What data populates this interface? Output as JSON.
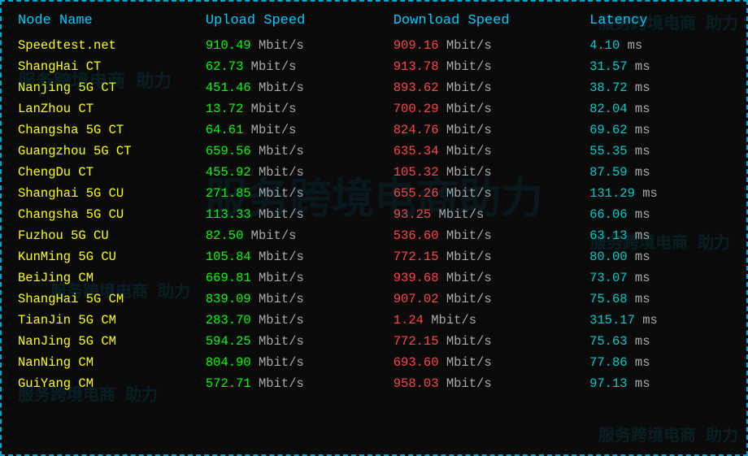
{
  "header": {
    "columns": [
      "Node Name",
      "Upload Speed",
      "Download Speed",
      "Latency"
    ]
  },
  "rows": [
    {
      "name": "Speedtest.net",
      "upload": "910.49",
      "download": "909.16",
      "latency": "4.10",
      "unit_u": "Mbit/s",
      "unit_d": "Mbit/s",
      "unit_l": "ms"
    },
    {
      "name": "ShangHai   CT",
      "upload": "62.73",
      "download": "913.78",
      "latency": "31.57",
      "unit_u": "Mbit/s",
      "unit_d": "Mbit/s",
      "unit_l": "ms"
    },
    {
      "name": "Nanjing 5G  CT",
      "upload": "451.46",
      "download": "893.62",
      "latency": "38.72",
      "unit_u": "Mbit/s",
      "unit_d": "Mbit/s",
      "unit_l": "ms"
    },
    {
      "name": "LanZhou   CT",
      "upload": "13.72",
      "download": "700.29",
      "latency": "82.04",
      "unit_u": "Mbit/s",
      "unit_d": "Mbit/s",
      "unit_l": "ms"
    },
    {
      "name": "Changsha 5G  CT",
      "upload": "64.61",
      "download": "824.76",
      "latency": "69.62",
      "unit_u": "Mbit/s",
      "unit_d": "Mbit/s",
      "unit_l": "ms"
    },
    {
      "name": "Guangzhou 5G CT",
      "upload": "659.56",
      "download": "635.34",
      "latency": "55.35",
      "unit_u": "Mbit/s",
      "unit_d": "Mbit/s",
      "unit_l": "ms"
    },
    {
      "name": "ChengDu   CT",
      "upload": "455.92",
      "download": "105.32",
      "latency": "87.59",
      "unit_u": "Mbit/s",
      "unit_d": "Mbit/s",
      "unit_l": "ms"
    },
    {
      "name": "Shanghai 5G  CU",
      "upload": "271.85",
      "download": "655.26",
      "latency": "131.29",
      "unit_u": "Mbit/s",
      "unit_d": "Mbit/s",
      "unit_l": "ms"
    },
    {
      "name": "Changsha 5G  CU",
      "upload": "113.33",
      "download": "93.25",
      "latency": "66.06",
      "unit_u": "Mbit/s",
      "unit_d": "Mbit/s",
      "unit_l": "ms"
    },
    {
      "name": "Fuzhou 5G   CU",
      "upload": "82.50",
      "download": "536.60",
      "latency": "63.13",
      "unit_u": "Mbit/s",
      "unit_d": "Mbit/s",
      "unit_l": "ms"
    },
    {
      "name": "KunMing 5G  CU",
      "upload": "105.84",
      "download": "772.15",
      "latency": "80.00",
      "unit_u": "Mbit/s",
      "unit_d": "Mbit/s",
      "unit_l": "ms"
    },
    {
      "name": "BeiJing    CM",
      "upload": "669.81",
      "download": "939.68",
      "latency": "73.07",
      "unit_u": "Mbit/s",
      "unit_d": "Mbit/s",
      "unit_l": "ms"
    },
    {
      "name": "ShangHai 5G  CM",
      "upload": "839.09",
      "download": "907.02",
      "latency": "75.68",
      "unit_u": "Mbit/s",
      "unit_d": "Mbit/s",
      "unit_l": "ms"
    },
    {
      "name": "TianJin 5G  CM",
      "upload": "283.70",
      "download": "1.24",
      "latency": "315.17",
      "unit_u": "Mbit/s",
      "unit_d": "Mbit/s",
      "unit_l": "ms"
    },
    {
      "name": "NanJing 5G  CM",
      "upload": "594.25",
      "download": "772.15",
      "latency": "75.63",
      "unit_u": "Mbit/s",
      "unit_d": "Mbit/s",
      "unit_l": "ms"
    },
    {
      "name": "NanNing    CM",
      "upload": "804.90",
      "download": "693.60",
      "latency": "77.86",
      "unit_u": "Mbit/s",
      "unit_d": "Mbit/s",
      "unit_l": "ms"
    },
    {
      "name": "GuiYang    CM",
      "upload": "572.71",
      "download": "958.03",
      "latency": "97.13",
      "unit_u": "Mbit/s",
      "unit_d": "Mbit/s",
      "unit_l": "ms"
    }
  ],
  "watermarks": {
    "tl": "服务跨境电商 助力",
    "tr": "服务跨境电商 助力",
    "center": "服务跨境电商助力",
    "bl": "服务跨境电商 助力",
    "br": "服务跨境电商 助力",
    "mid_r": "服务跨境电商 助力",
    "mid_l": "服务跨境电商 助力"
  }
}
